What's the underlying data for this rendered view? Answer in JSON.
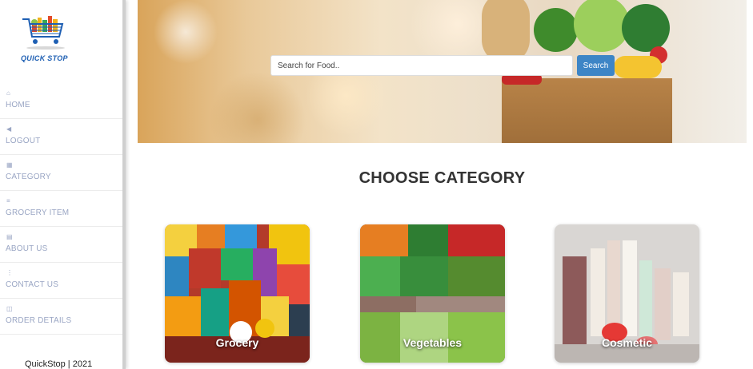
{
  "brand": {
    "logo_text": "QUICK STOP",
    "accent": "#1e5fb3"
  },
  "sidebar": {
    "items": [
      {
        "label": "HOME",
        "icon": "home-icon"
      },
      {
        "label": "LOGOUT",
        "icon": "logout-icon"
      },
      {
        "label": "CATEGORY",
        "icon": "grid-icon"
      },
      {
        "label": "GROCERY ITEM",
        "icon": "list-icon"
      },
      {
        "label": "ABOUT US",
        "icon": "info-icon"
      },
      {
        "label": "CONTACT US",
        "icon": "contact-icon"
      },
      {
        "label": "ORDER DETAILS",
        "icon": "receipt-icon"
      }
    ],
    "footer": "QuickStop | 2021"
  },
  "search": {
    "placeholder": "Search for Food..",
    "button_label": "Search",
    "button_color": "#3d85c6"
  },
  "main": {
    "heading": "CHOOSE CATEGORY",
    "categories": [
      {
        "label": "Grocery"
      },
      {
        "label": "Vegetables"
      },
      {
        "label": "Cosmetic"
      }
    ]
  }
}
